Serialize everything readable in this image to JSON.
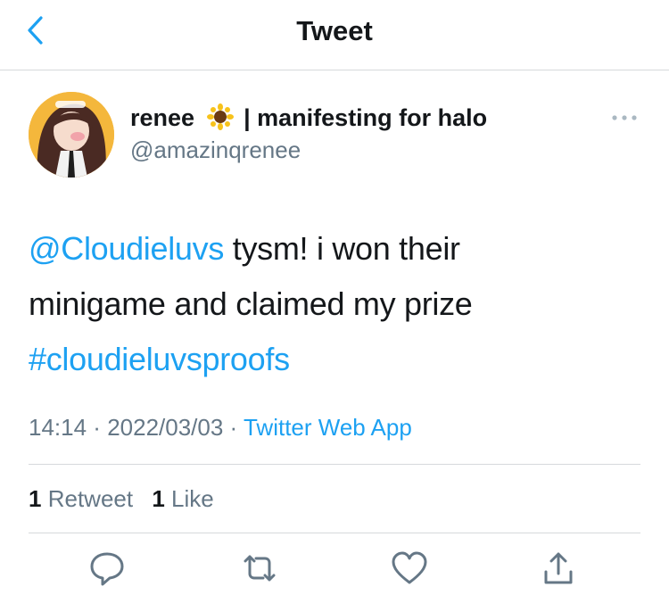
{
  "header": {
    "title": "Tweet"
  },
  "author": {
    "display_name": "renee",
    "display_name_suffix": "| manifesting for halo",
    "emoji": "sunflower",
    "handle": "@amazinqrenee"
  },
  "tweet": {
    "line1_mention": "@Cloudieluvs",
    "line1_text": " tysm! i won their",
    "line2_text": "minigame and claimed my prize",
    "line3_hashtag": "#cloudieluvsproofs"
  },
  "meta": {
    "time": "14:14",
    "dot1": " · ",
    "date": "2022/03/03",
    "dot2": " · ",
    "source": "Twitter Web App"
  },
  "stats": {
    "retweets_count": "1",
    "retweets_label": "Retweet",
    "likes_count": "1",
    "likes_label": "Like"
  },
  "icons": {
    "back": "chevron-left-icon",
    "more": "more-horizontal-icon",
    "reply": "reply-icon",
    "retweet": "retweet-icon",
    "like": "heart-icon",
    "share": "share-icon"
  },
  "colors": {
    "accent": "#1da1f2",
    "text": "#14171a",
    "secondary": "#657786",
    "divider": "#d6d9dc"
  }
}
